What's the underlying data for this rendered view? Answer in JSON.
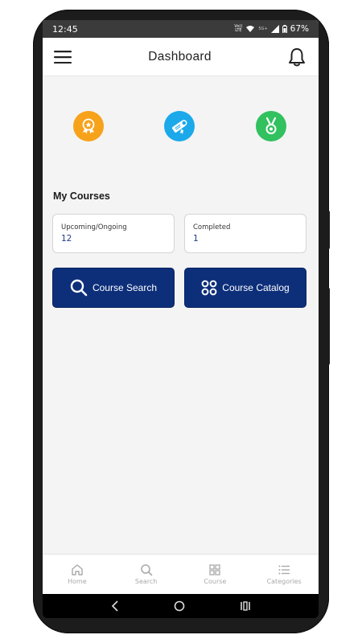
{
  "status_bar": {
    "time": "12:45",
    "volte_label": "Vo)) LTE",
    "network_label": "5G+",
    "battery": "67%"
  },
  "header": {
    "title": "Dashboard",
    "menu_icon": "hamburger-menu-icon",
    "notification_icon": "bell-icon"
  },
  "badges": [
    {
      "icon": "award-ribbon-icon",
      "color": "#f7a21b"
    },
    {
      "icon": "certificate-diploma-icon",
      "color": "#1ba9ea"
    },
    {
      "icon": "medal-icon",
      "color": "#31c15f"
    }
  ],
  "my_courses": {
    "title": "My Courses",
    "upcoming_label": "Upcoming/Ongoing",
    "upcoming_value": "12",
    "completed_label": "Completed",
    "completed_value": "1"
  },
  "actions": {
    "search_label": "Course Search",
    "catalog_label": "Course Catalog"
  },
  "bottom_nav": {
    "home": "Home",
    "search": "Search",
    "course": "Course",
    "categories": "Categories"
  },
  "colors": {
    "primary": "#0d2f7a",
    "value_text": "#1f3a8a"
  }
}
